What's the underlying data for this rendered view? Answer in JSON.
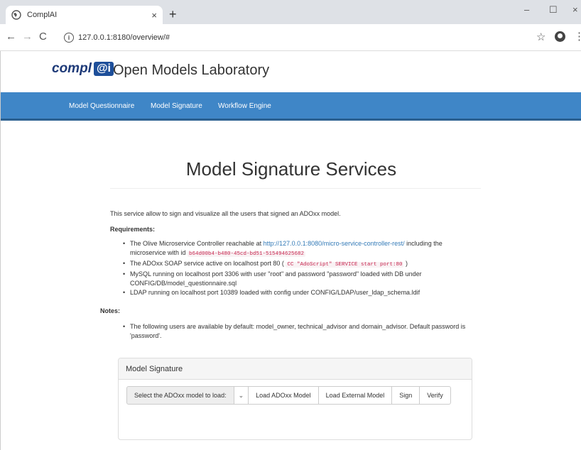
{
  "browser": {
    "tab_title": "ComplAI",
    "tab_close": "×",
    "new_tab": "+",
    "url": "127.0.0.1:8180/overview/#",
    "window_controls": [
      "–",
      "☐",
      "×"
    ]
  },
  "header": {
    "logo_text": "compl",
    "logo_box": "@i",
    "site_title": "Open Models Laboratory"
  },
  "nav": {
    "items": [
      "Model Questionnaire",
      "Model Signature",
      "Workflow Engine"
    ]
  },
  "main": {
    "heading": "Model Signature Services",
    "intro": "This service allow to sign and visualize all the users that signed an ADOxx model.",
    "requirements_title": "Requirements:",
    "req1_pre": "The Olive Microservice Controller reachable at ",
    "req1_link": "http://127.0.0.1:8080/micro-service-controller-rest/",
    "req1_mid": " including the microservice with id ",
    "req1_code": "b64d00b4-b480-45cd-bd51-515494625682",
    "req2_pre": "The ADOxx SOAP service active on localhost port 80 ( ",
    "req2_code": "CC \"AdoScript\" SERVICE start port:80",
    "req2_post": " )",
    "req3": "MySQL running on localhost port 3306 with user \"root\" and password \"password\" loaded with DB under CONFIG/DB/model_questionnaire.sql",
    "req4": "LDAP running on localhost port 10389 loaded with config under CONFIG/LDAP/user_ldap_schema.ldif",
    "notes_title": "Notes:",
    "note1": "The following users are available by default: model_owner, technical_advisor and domain_advisor. Default password is 'password'."
  },
  "panel": {
    "title": "Model Signature",
    "select_label": "Select the ADOxx model to load:",
    "select_chevron": "⌄",
    "buttons": [
      "Load ADOxx Model",
      "Load External Model",
      "Sign",
      "Verify"
    ]
  }
}
